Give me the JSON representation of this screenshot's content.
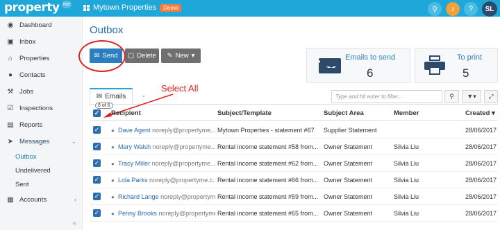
{
  "topbar": {
    "logo": "property",
    "logo_me": "me",
    "org_name": "Mytown Properties",
    "demo_badge": "Demo",
    "user_initials": "SL"
  },
  "sidebar": {
    "items": [
      {
        "label": "Dashboard",
        "icon": "dashboard-icon"
      },
      {
        "label": "Inbox",
        "icon": "inbox-icon"
      },
      {
        "label": "Properties",
        "icon": "home-icon"
      },
      {
        "label": "Contacts",
        "icon": "person-icon"
      },
      {
        "label": "Jobs",
        "icon": "wrench-icon"
      },
      {
        "label": "Inspections",
        "icon": "clipboard-icon"
      },
      {
        "label": "Reports",
        "icon": "report-icon"
      },
      {
        "label": "Messages",
        "icon": "send-icon"
      }
    ],
    "sub_items": [
      "Outbox",
      "Undelivered",
      "Sent"
    ],
    "accounts": "Accounts"
  },
  "page": {
    "title": "Outbox",
    "buttons": {
      "send": "Send",
      "delete": "Delete",
      "new": "New"
    },
    "stats": {
      "emails_label": "Emails to send",
      "emails_value": "6",
      "print_label": "To print",
      "print_value": "5"
    },
    "tab_label": "Emails",
    "tab_count": "6 of 6",
    "annotation": "Select All",
    "filter_placeholder": "Type and hit enter to filter..."
  },
  "table": {
    "headers": {
      "recipient": "Recipient",
      "subject": "Subject/Template",
      "area": "Subject Area",
      "member": "Member",
      "created": "Created"
    },
    "rows": [
      {
        "name": "Dave Agent",
        "email": "noreply@propertyme...",
        "subject": "Mytown Properties - statement #67",
        "area": "Supplier Statement",
        "member": "",
        "created": "28/06/2017"
      },
      {
        "name": "Mary Walsh",
        "email": "noreply@propertyme...",
        "subject": "Rental income statement #58 from...",
        "area": "Owner Statement",
        "member": "Silvia Liu",
        "created": "28/06/2017"
      },
      {
        "name": "Tracy Miller",
        "email": "noreply@propertyme...",
        "subject": "Rental income statement #62 from...",
        "area": "Owner Statement",
        "member": "Silvia Liu",
        "created": "28/06/2017"
      },
      {
        "name": "Lola Parks",
        "email": "noreply@propertyme.c...",
        "subject": "Rental income statement #66 from...",
        "area": "Owner Statement",
        "member": "Silvia Liu",
        "created": "28/06/2017"
      },
      {
        "name": "Richard Lange",
        "email": "noreply@propertym...",
        "subject": "Rental income statement #59 from...",
        "area": "Owner Statement",
        "member": "Silvia Liu",
        "created": "28/06/2017"
      },
      {
        "name": "Penny Brooks",
        "email": "noreply@propertyme...",
        "subject": "Rental income statement #65 from...",
        "area": "Owner Statement",
        "member": "Silvia Liu",
        "created": "28/06/2017"
      }
    ]
  },
  "colors": {
    "topbar": "#1ea7d8",
    "primary_button": "#2b7fc0",
    "annotation": "#e02020"
  }
}
